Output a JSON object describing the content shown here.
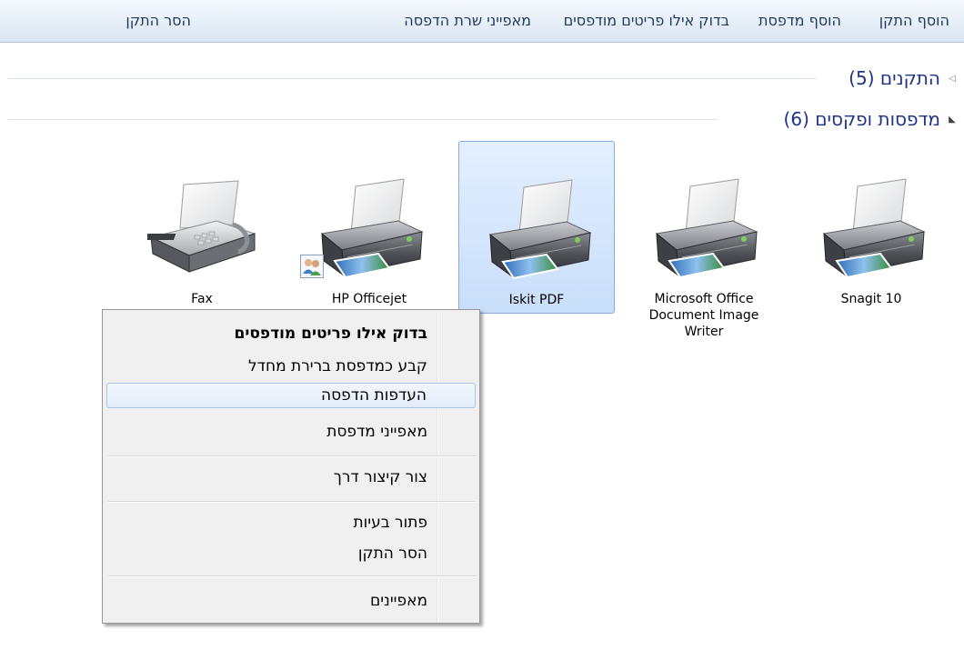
{
  "toolbar": {
    "add_device": "הוסף התקן",
    "add_printer": "הוסף מדפסת",
    "see_whats_printing": "בדוק אילו פריטים מודפסים",
    "print_server_properties": "מאפייני שרת הדפסה",
    "remove_device": "הסר התקן"
  },
  "groups": {
    "devices": {
      "label": "התקנים (5)",
      "state": "collapsed"
    },
    "printers": {
      "label": "מדפסות ופקסים (6)",
      "state": "expanded"
    }
  },
  "devices": [
    {
      "name": "Snagit 10",
      "icon": "printer-icon"
    },
    {
      "name": "Microsoft Office Document Image Writer",
      "icon": "printer-icon"
    },
    {
      "name": "Iskit PDF",
      "icon": "printer-icon",
      "selected": true
    },
    {
      "name": "HP Officejet",
      "icon": "shared-printer-icon"
    },
    {
      "name": "Fax",
      "icon": "fax-icon"
    }
  ],
  "context_menu": {
    "items": [
      {
        "label": "בדוק אילו פריטים מודפסים",
        "bold": true
      },
      {
        "label": "קבע כמדפסת ברירת מחדל"
      },
      {
        "label": "העדפות הדפסה",
        "hover": true
      },
      {
        "label": "מאפייני מדפסת"
      },
      {
        "label": "צור קיצור דרך"
      },
      {
        "label": "פתור בעיות"
      },
      {
        "label": "הסר התקן"
      },
      {
        "label": "מאפיינים"
      }
    ]
  },
  "colors": {
    "accent": "#1e3287",
    "selection_fill": "#c9defa",
    "selection_border": "#84acdd"
  }
}
